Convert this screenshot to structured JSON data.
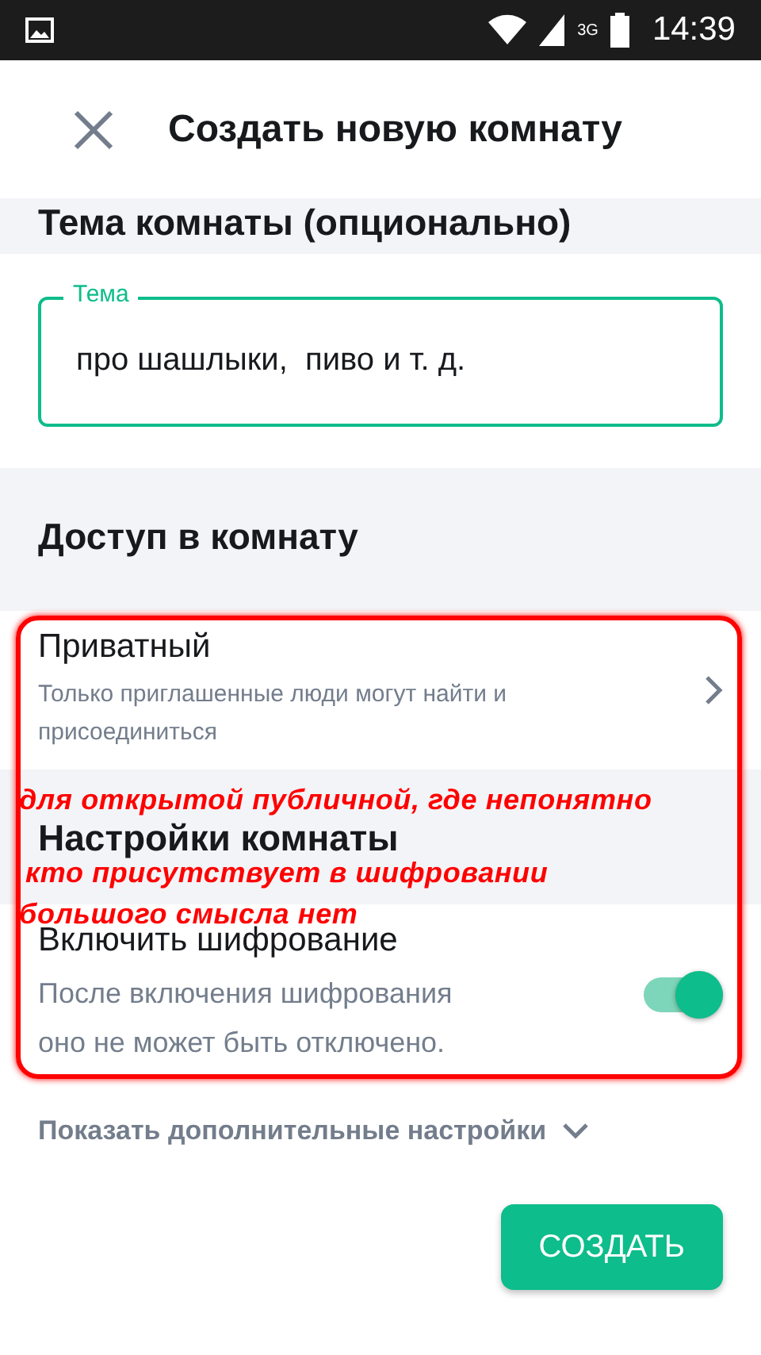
{
  "status_bar": {
    "time": "14:39",
    "network": "3G"
  },
  "header": {
    "title": "Создать новую комнату"
  },
  "topic_section": {
    "heading": "Тема комнаты (опционально)",
    "field": {
      "label": "Тема",
      "value": "про шашлыки,  пиво и т. д."
    }
  },
  "access_section": {
    "heading": "Доступ в комнату",
    "option": {
      "title": "Приватный",
      "description": "Только приглашенные люди могут найти и присоединиться"
    }
  },
  "settings_section": {
    "heading": "Настройки комнаты",
    "encryption": {
      "title": "Включить шифрование",
      "description": "После включения шифрования оно не может быть отключено.",
      "on": true
    }
  },
  "more_settings": "Показать дополнительные настройки",
  "create_button": "СОЗДАТЬ",
  "annotation": {
    "lines": [
      "для открытой публичной, где непонятно",
      "кто присутствует в шифровании",
      "большого смысла нет"
    ]
  }
}
